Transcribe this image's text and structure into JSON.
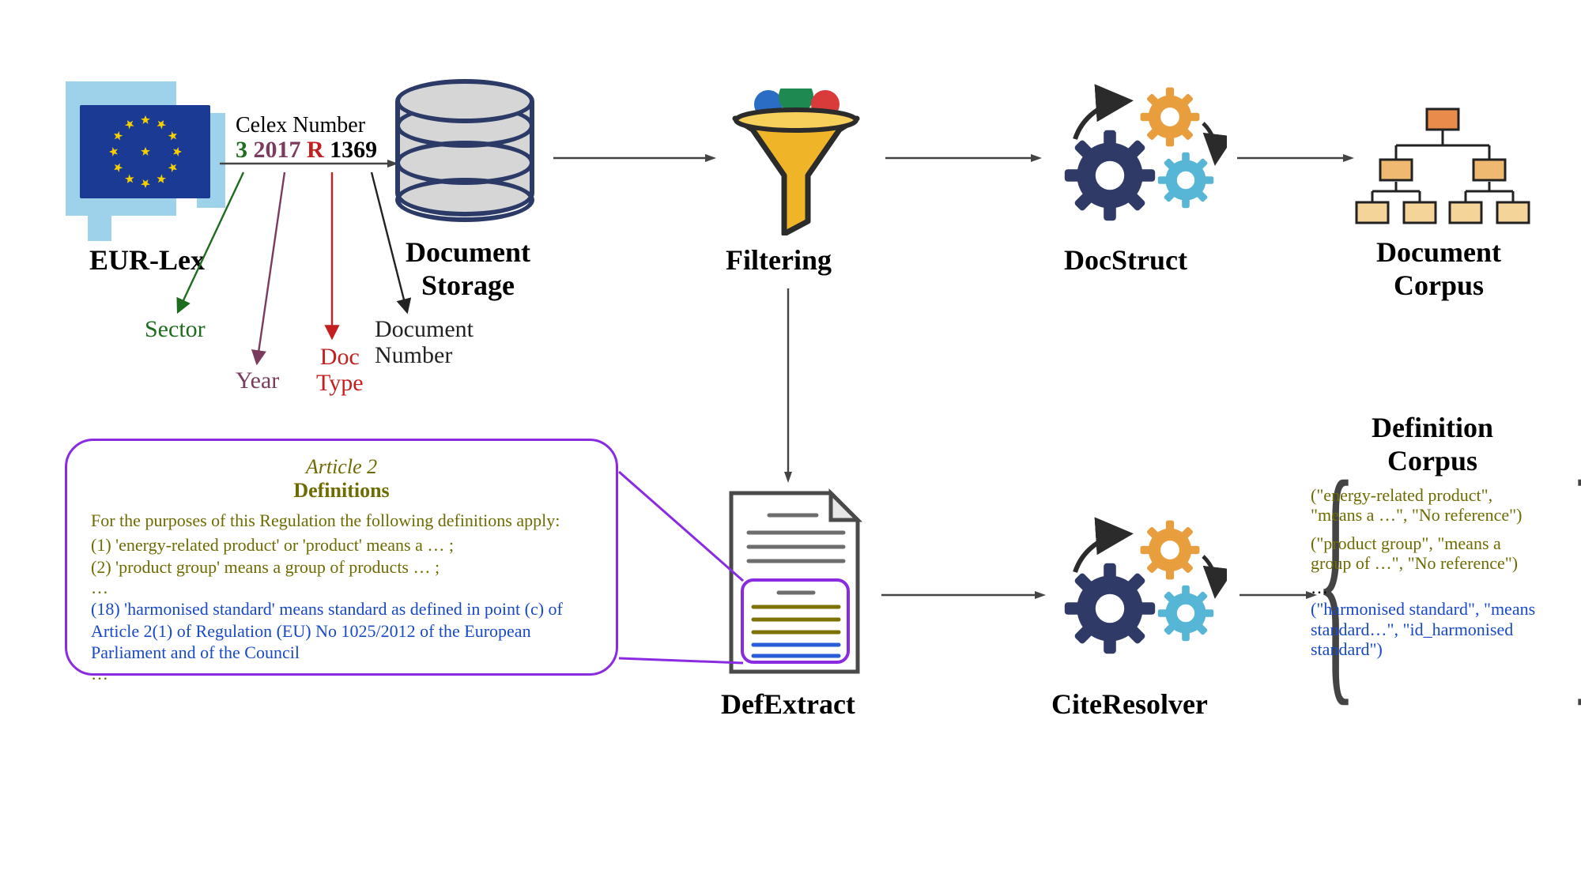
{
  "stages": {
    "eurlex": "EUR-Lex",
    "storage": "Document\nStorage",
    "filtering": "Filtering",
    "docstruct": "DocStruct",
    "doccorpus": "Document\nCorpus",
    "defextract": "DefExtract",
    "cite": "CiteResolver",
    "defcorpus": "Definition\nCorpus"
  },
  "celex": {
    "title": "Celex Number",
    "sector": "3",
    "year": "2017",
    "doctype": "R",
    "number": "1369",
    "legend": {
      "sector": "Sector",
      "year": "Year",
      "doctype": "Doc\nType",
      "number": "Document\nNumber"
    }
  },
  "callout": {
    "article": "Article 2",
    "heading": "Definitions",
    "intro": "For the purposes of this Regulation the following definitions apply:",
    "items_gold": [
      "(1) 'energy-related product' or 'product' means a … ;",
      "(2) 'product group' means a group of products … ;"
    ],
    "ellipsis": "…",
    "item_blue": "(18)  'harmonised standard' means standard as defined in point (c) of Article 2(1) of Regulation (EU) No 1025/2012 of the European Parliament and of the Council"
  },
  "defcorpus": {
    "t1a": "(\"energy-related product\"",
    "t1b": ", \"means a …\", \"No reference\")",
    "t2a": "(\"product group\"",
    "t2b": ", \"means a group of …\", \"No reference\")",
    "ellipsis": "…",
    "t3a": "(\"harmonised standard\"",
    "t3b": ", \"means standard…\", \"id_harmonised standard\")"
  }
}
